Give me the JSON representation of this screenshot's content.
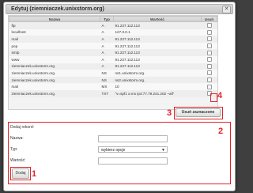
{
  "dialog": {
    "title": "Edytuj (ziemniaczek.unixstorm.org)",
    "close_label": "✕"
  },
  "table": {
    "headers": [
      "Nazwa",
      "Typ",
      "Wartość",
      "Usuń"
    ],
    "rows": [
      {
        "name": "ftp",
        "type": "A",
        "value": "91.227.112.113"
      },
      {
        "name": "localhost",
        "type": "A",
        "value": "127.0.0.1"
      },
      {
        "name": "mail",
        "type": "A",
        "value": "91.227.112.113"
      },
      {
        "name": "pop",
        "type": "A",
        "value": "91.227.112.113"
      },
      {
        "name": "smtp",
        "type": "A",
        "value": "91.227.112.113"
      },
      {
        "name": "www",
        "type": "A",
        "value": "91.227.112.113"
      },
      {
        "name": "ziemniaczek.unixstorm.org.",
        "type": "A",
        "value": "91.227.112.113"
      },
      {
        "name": "ziemniaczek.unixstorm.org.",
        "type": "NS",
        "value": "ns1.unixstorm.org."
      },
      {
        "name": "ziemniaczek.unixstorm.org.",
        "type": "NS",
        "value": "ns2.unixstorm.org."
      },
      {
        "name": "mail",
        "type": "MX",
        "value": "10"
      },
      {
        "name": "ziemniaczek.unixstorm.org.",
        "type": "TXT",
        "value": "\"v=spf1 a mx ip4:77.79.241.202 ~all\""
      }
    ]
  },
  "delete_button": {
    "label": "Usuń zaznaczone"
  },
  "add_form": {
    "heading": "Dodaj rekord:",
    "name_label": "Nazwa:",
    "name_value": "",
    "type_label": "Typ:",
    "type_selected": "wybierz opcje",
    "value_label": "Wartość:",
    "value_value": "",
    "submit_label": "Dodaj"
  },
  "markers": {
    "m1": "1",
    "m2": "2",
    "m3": "3",
    "m4": "4"
  },
  "colors": {
    "annotation": "#e0252a",
    "backdrop": "#3f3f3f"
  }
}
